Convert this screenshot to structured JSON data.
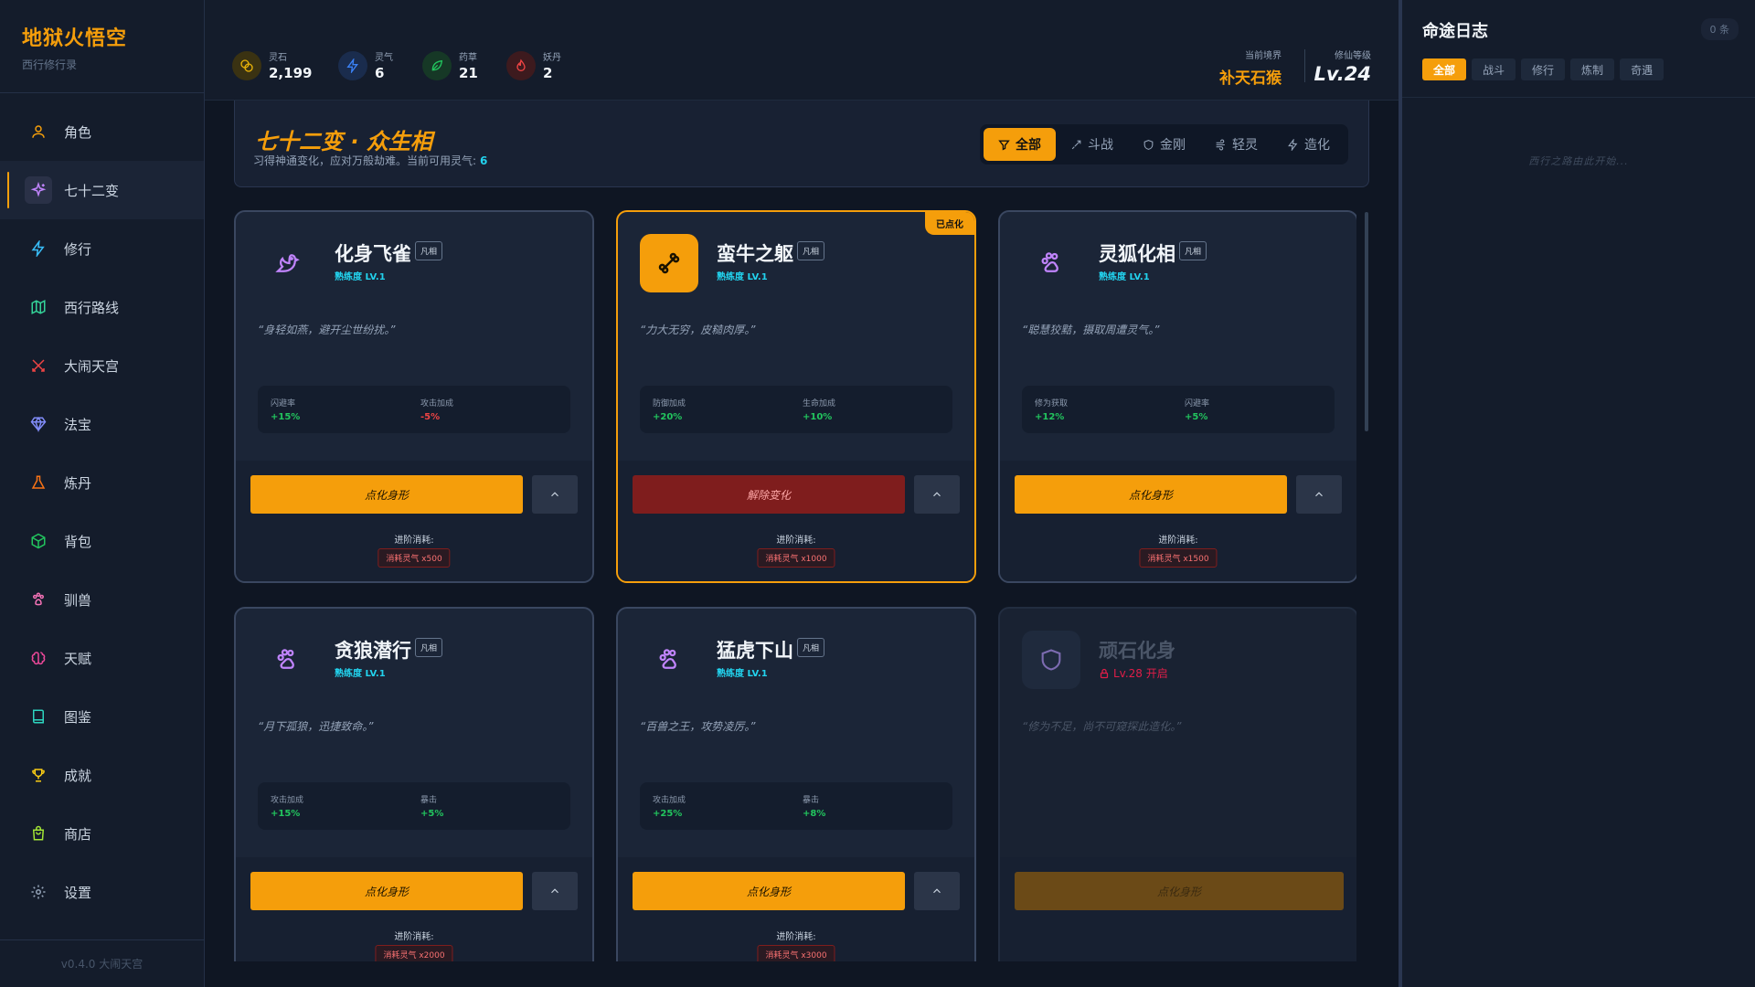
{
  "brand": {
    "title": "地狱火悟空",
    "subtitle": "西行修行录"
  },
  "nav": [
    {
      "label": "角色",
      "icon": "user-icon"
    },
    {
      "label": "七十二变",
      "icon": "sparkles-icon"
    },
    {
      "label": "修行",
      "icon": "lightning-icon"
    },
    {
      "label": "西行路线",
      "icon": "map-icon"
    },
    {
      "label": "大闹天宫",
      "icon": "swords-icon"
    },
    {
      "label": "法宝",
      "icon": "gem-icon"
    },
    {
      "label": "炼丹",
      "icon": "flask-icon"
    },
    {
      "label": "背包",
      "icon": "package-icon"
    },
    {
      "label": "驯兽",
      "icon": "paw-icon"
    },
    {
      "label": "天赋",
      "icon": "brain-icon"
    },
    {
      "label": "图鉴",
      "icon": "book-icon"
    },
    {
      "label": "成就",
      "icon": "trophy-icon"
    },
    {
      "label": "商店",
      "icon": "shop-icon"
    },
    {
      "label": "设置",
      "icon": "gear-icon"
    }
  ],
  "version": "v0.4.0 大闹天宫",
  "resources": [
    {
      "label": "灵石",
      "value": "2,199",
      "color": "#eab308"
    },
    {
      "label": "灵气",
      "value": "6",
      "color": "#3b82f6"
    },
    {
      "label": "药草",
      "value": "21",
      "color": "#22c55e"
    },
    {
      "label": "妖丹",
      "value": "2",
      "color": "#ef4444"
    }
  ],
  "realm": {
    "label": "当前境界",
    "value": "补天石猴"
  },
  "level": {
    "label": "修仙等级",
    "value": "Lv.24"
  },
  "panel": {
    "title": "七十二变 · 众生相",
    "subtitle": "习得神通变化，应对万般劫难。当前可用灵气:",
    "qi": "6",
    "filters": [
      {
        "label": "全部",
        "active": true
      },
      {
        "label": "斗战",
        "active": false
      },
      {
        "label": "金刚",
        "active": false
      },
      {
        "label": "轻灵",
        "active": false
      },
      {
        "label": "造化",
        "active": false
      }
    ]
  },
  "cards": [
    {
      "name": "化身飞雀",
      "tag": "凡相",
      "level": "熟练度 LV.1",
      "desc": "“身轻如燕，避开尘世纷扰。”",
      "stats": [
        {
          "label": "闪避率",
          "value": "+15%",
          "pos": true
        },
        {
          "label": "攻击加成",
          "value": "-5%",
          "pos": false
        }
      ],
      "action": "点化身形",
      "cost_label": "进阶消耗:",
      "cost": "消耗灵气 x500",
      "icon": "bird-icon"
    },
    {
      "name": "蛮牛之躯",
      "tag": "凡相",
      "level": "熟练度 LV.1",
      "desc": "“力大无穷，皮糙肉厚。”",
      "corner": "已点化",
      "stats": [
        {
          "label": "防御加成",
          "value": "+20%",
          "pos": true
        },
        {
          "label": "生命加成",
          "value": "+10%",
          "pos": true
        }
      ],
      "action": "解除变化",
      "cost_label": "进阶消耗:",
      "cost": "消耗灵气 x1000",
      "icon": "bone-icon"
    },
    {
      "name": "灵狐化相",
      "tag": "凡相",
      "level": "熟练度 LV.1",
      "desc": "“聪慧狡黠，摄取周遭灵气。”",
      "stats": [
        {
          "label": "修为获取",
          "value": "+12%",
          "pos": true
        },
        {
          "label": "闪避率",
          "value": "+5%",
          "pos": true
        }
      ],
      "action": "点化身形",
      "cost_label": "进阶消耗:",
      "cost": "消耗灵气 x1500",
      "icon": "paw-icon"
    },
    {
      "name": "贪狼潜行",
      "tag": "凡相",
      "level": "熟练度 LV.1",
      "desc": "“月下孤狼，迅捷致命。”",
      "stats": [
        {
          "label": "攻击加成",
          "value": "+15%",
          "pos": true
        },
        {
          "label": "暴击",
          "value": "+5%",
          "pos": true
        }
      ],
      "action": "点化身形",
      "cost_label": "进阶消耗:",
      "cost": "消耗灵气 x2000",
      "icon": "paw-icon"
    },
    {
      "name": "猛虎下山",
      "tag": "凡相",
      "level": "熟练度 LV.1",
      "desc": "“百兽之王，攻势凌厉。”",
      "stats": [
        {
          "label": "攻击加成",
          "value": "+25%",
          "pos": true
        },
        {
          "label": "暴击",
          "value": "+8%",
          "pos": true
        }
      ],
      "action": "点化身形",
      "cost_label": "进阶消耗:",
      "cost": "消耗灵气 x3000",
      "icon": "paw-icon"
    },
    {
      "name": "顽石化身",
      "lock": "Lv.28 开启",
      "desc": "“修为不足，尚不可窥探此造化。”",
      "action": "点化身形",
      "icon": "shield-icon"
    }
  ],
  "log": {
    "title": "命途日志",
    "count": "0 条",
    "tabs": [
      {
        "label": "全部",
        "active": true
      },
      {
        "label": "战斗",
        "active": false
      },
      {
        "label": "修行",
        "active": false
      },
      {
        "label": "炼制",
        "active": false
      },
      {
        "label": "奇遇",
        "active": false
      }
    ],
    "empty": "西行之路由此开始..."
  }
}
